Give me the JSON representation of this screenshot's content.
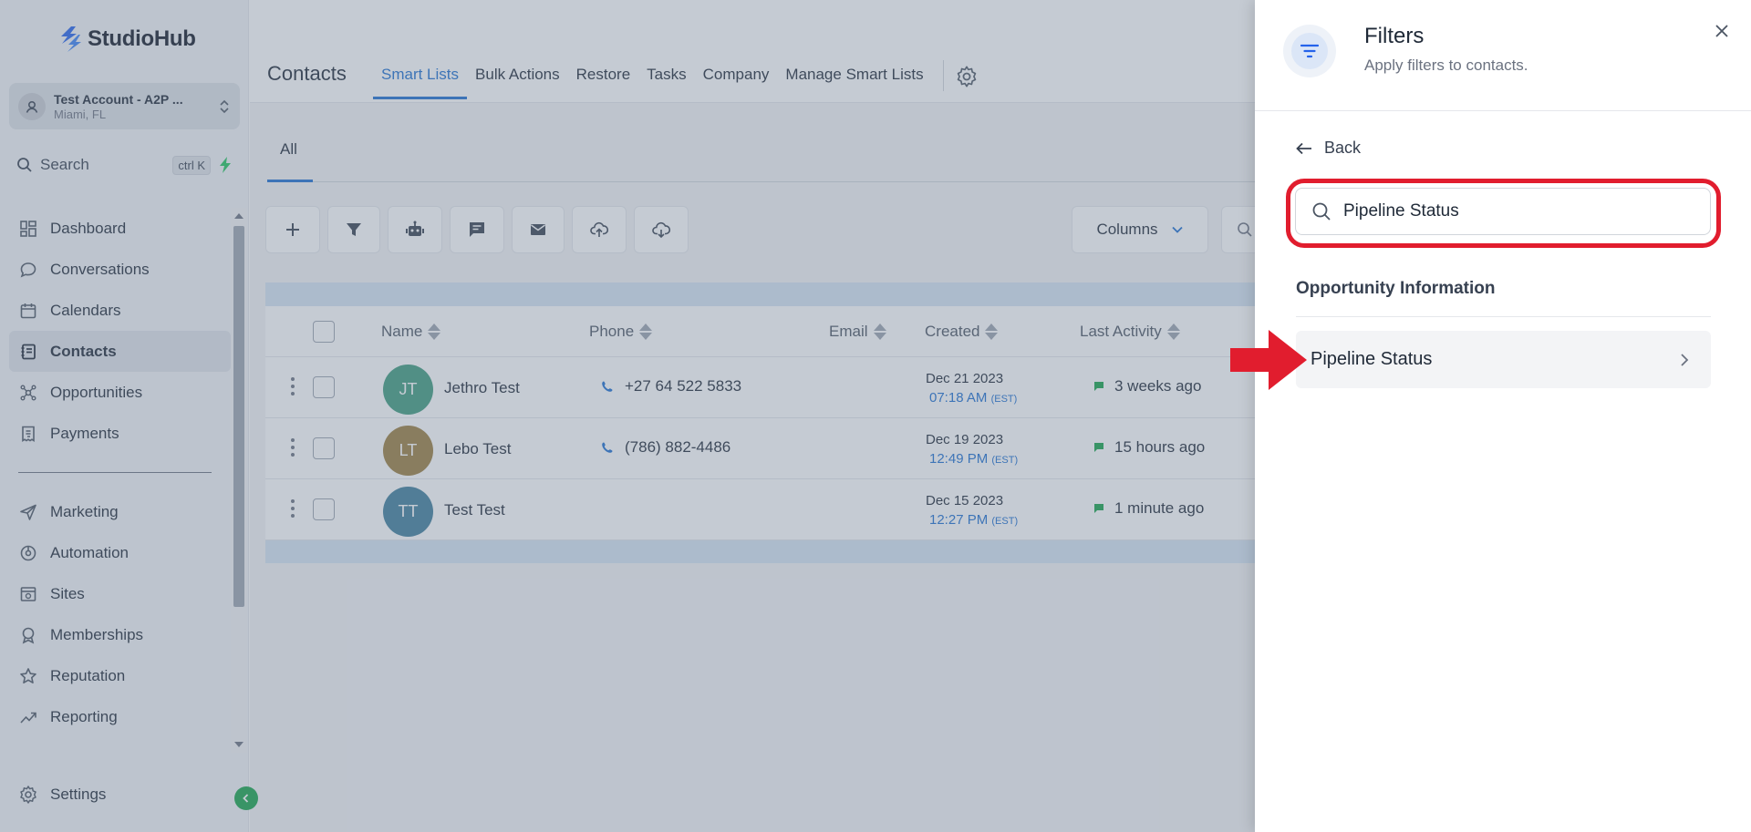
{
  "app": {
    "brand": "StudioHub",
    "account": {
      "name": "Test Account - A2P ...",
      "location": "Miami, FL"
    },
    "search": {
      "label": "Search",
      "shortcut": "ctrl K"
    }
  },
  "sidebar": {
    "items": [
      {
        "label": "Dashboard",
        "icon": "dashboard-icon"
      },
      {
        "label": "Conversations",
        "icon": "chat-bubble-icon"
      },
      {
        "label": "Calendars",
        "icon": "calendar-icon"
      },
      {
        "label": "Contacts",
        "icon": "contacts-book-icon",
        "active": true
      },
      {
        "label": "Opportunities",
        "icon": "opportunities-icon"
      },
      {
        "label": "Payments",
        "icon": "receipt-icon"
      }
    ],
    "items2": [
      {
        "label": "Marketing",
        "icon": "send-icon"
      },
      {
        "label": "Automation",
        "icon": "automation-icon"
      },
      {
        "label": "Sites",
        "icon": "sites-icon"
      },
      {
        "label": "Memberships",
        "icon": "memberships-icon"
      },
      {
        "label": "Reputation",
        "icon": "star-icon"
      },
      {
        "label": "Reporting",
        "icon": "trend-icon"
      }
    ],
    "settings": "Settings"
  },
  "header": {
    "title": "Contacts",
    "tabs": [
      {
        "label": "Smart Lists",
        "active": true
      },
      {
        "label": "Bulk Actions"
      },
      {
        "label": "Restore"
      },
      {
        "label": "Tasks"
      },
      {
        "label": "Company"
      },
      {
        "label": "Manage Smart Lists"
      }
    ]
  },
  "list_tabs": [
    {
      "label": "All",
      "active": true
    }
  ],
  "toolbar": {
    "columns_label": "Columns"
  },
  "table": {
    "columns": [
      "Name",
      "Phone",
      "Email",
      "Created",
      "Last Activity"
    ],
    "rows": [
      {
        "initials": "JT",
        "avatar_color": "#3f9b7e",
        "name": "Jethro Test",
        "phone": "+27 64 522 5833",
        "email": "",
        "created_date": "Dec 21 2023",
        "created_time": "07:18 AM",
        "created_tz": "(EST)",
        "activity": "3 weeks ago"
      },
      {
        "initials": "LT",
        "avatar_color": "#9b7e3f",
        "name": "Lebo Test",
        "phone": "(786) 882-4486",
        "email": "",
        "created_date": "Dec 19 2023",
        "created_time": "12:49 PM",
        "created_tz": "(EST)",
        "activity": "15 hours ago"
      },
      {
        "initials": "TT",
        "avatar_color": "#3f7e9b",
        "name": "Test Test",
        "phone": "",
        "email": "",
        "created_date": "Dec 15 2023",
        "created_time": "12:27 PM",
        "created_tz": "(EST)",
        "activity": "1 minute ago"
      }
    ]
  },
  "filters_panel": {
    "title": "Filters",
    "subtitle": "Apply filters to contacts.",
    "back_label": "Back",
    "search_value": "Pipeline Status",
    "section_title": "Opportunity Information",
    "options": [
      {
        "label": "Pipeline Status"
      }
    ]
  },
  "colors": {
    "accent": "#1d6fd1",
    "highlight_red": "#e11d2e",
    "activity_green": "#16a34a"
  }
}
